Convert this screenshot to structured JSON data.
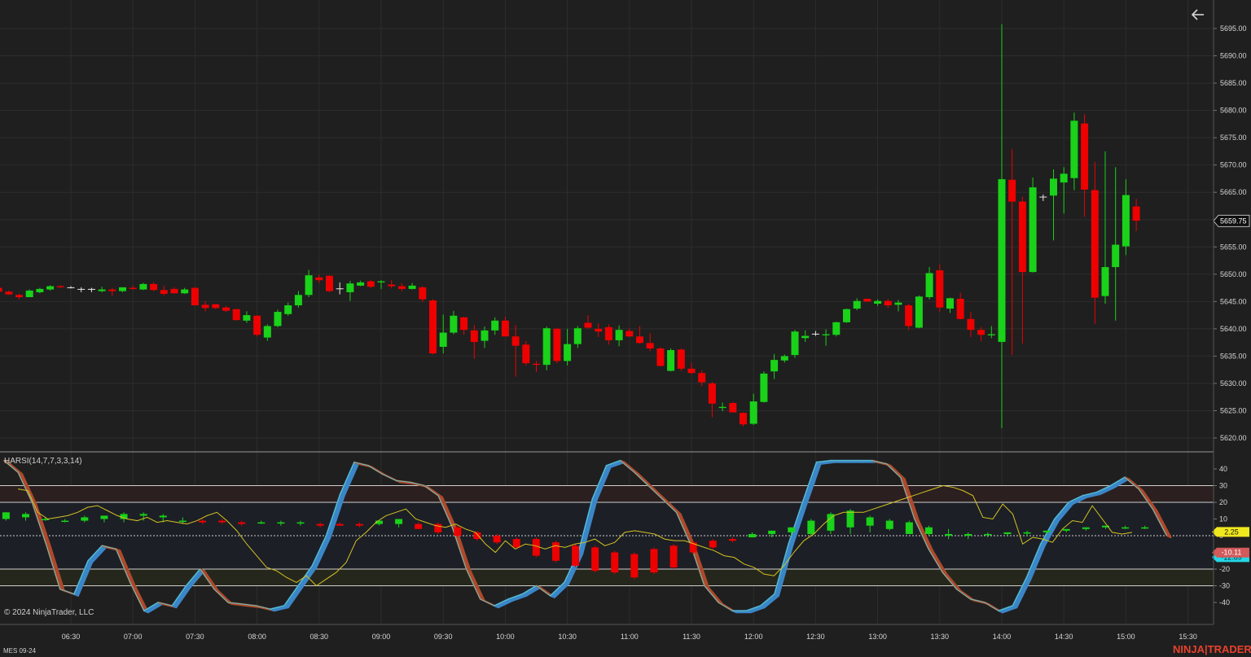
{
  "instrument": "MES 09-24",
  "brand": {
    "left": "NINJA",
    "right": "TRADER",
    "color": "#e8412c"
  },
  "copyright": "© 2024 NinjaTrader, LLC",
  "indicator_label": "HARSI(14,7,7,3,3,14)",
  "colors": {
    "up": "#19d219",
    "down": "#ee0000",
    "background": "#1f1f1f",
    "grid": "#2d2d2d",
    "text": "#d6d6d6",
    "rsi_line": "#d4c322",
    "stoch_up": "#3a86c8",
    "stoch_down": "#b0482a"
  },
  "price_axis": {
    "ticks": [
      "5695.00",
      "5690.00",
      "5685.00",
      "5680.00",
      "5675.00",
      "5670.00",
      "5665.00",
      "5660.00",
      "5655.00",
      "5650.00",
      "5645.00",
      "5640.00",
      "5635.00",
      "5630.00",
      "5625.00",
      "5620.00"
    ],
    "current_price": "5659.75"
  },
  "oscillator_axis": {
    "ticks": [
      "40",
      "30",
      "20",
      "10",
      "0",
      "-10",
      "-20",
      "-30",
      "-40"
    ],
    "label_rsi": "2.25",
    "label_red": "-10.11",
    "label_cyan": "-12.89"
  },
  "time_axis": {
    "ticks": [
      "06:30",
      "07:00",
      "07:30",
      "08:00",
      "08:30",
      "09:00",
      "09:30",
      "10:00",
      "10:30",
      "11:00",
      "11:30",
      "12:00",
      "12:30",
      "13:00",
      "13:30",
      "14:00",
      "14:30",
      "15:00",
      "15:30"
    ]
  },
  "chart_data": {
    "type": "candlestick",
    "price_range": [
      5618,
      5698
    ],
    "bar_spacing_minutes": 5,
    "first_bar": "05:50",
    "candles": [
      [
        5647.5,
        5648,
        5647,
        5647.6
      ],
      [
        5647.5,
        5647.6,
        5646.6,
        5646.8
      ],
      [
        5646.8,
        5647,
        5646.2,
        5646.3
      ],
      [
        5646.2,
        5646.4,
        5645.4,
        5645.8
      ],
      [
        5645.8,
        5647.2,
        5645.8,
        5647
      ],
      [
        5646.7,
        5647.5,
        5646.5,
        5647.3
      ],
      [
        5647.2,
        5648,
        5647,
        5647.8
      ],
      [
        5647.8,
        5648,
        5647.5,
        5647.6
      ],
      [
        5647.6,
        5647.8,
        5647.4,
        5647.5
      ],
      [
        5647.3,
        5647.6,
        5646.7,
        5647.2
      ],
      [
        5647.2,
        5647.5,
        5646.7,
        5647.3
      ],
      [
        5646.9,
        5647.7,
        5646.7,
        5647.2
      ],
      [
        5647.2,
        5647.5,
        5646,
        5646.9
      ],
      [
        5646.9,
        5647.6,
        5646.7,
        5647.6
      ],
      [
        5647.5,
        5647.9,
        5647.1,
        5647.3
      ],
      [
        5647.2,
        5648.4,
        5647.1,
        5648.2
      ],
      [
        5648.2,
        5648.5,
        5646.9,
        5647.1
      ],
      [
        5647.1,
        5647.9,
        5646.1,
        5646.4
      ],
      [
        5647.3,
        5647.6,
        5646.5,
        5646.5
      ],
      [
        5646.5,
        5647.5,
        5646.4,
        5647.2
      ],
      [
        5647.5,
        5647.6,
        5644.3,
        5644.3
      ],
      [
        5644.4,
        5645.1,
        5643.2,
        5643.8
      ],
      [
        5644.5,
        5644.5,
        5643.6,
        5643.8
      ],
      [
        5643.9,
        5644.2,
        5643.1,
        5643.3
      ],
      [
        5643.6,
        5643.6,
        5641.5,
        5641.6
      ],
      [
        5641.5,
        5643.2,
        5641.1,
        5642.5
      ],
      [
        5642.4,
        5642.5,
        5638.6,
        5638.9
      ],
      [
        5638.4,
        5640.8,
        5637.8,
        5640.5
      ],
      [
        5640.5,
        5643.5,
        5640.3,
        5643.1
      ],
      [
        5642.7,
        5644.8,
        5642.4,
        5644.3
      ],
      [
        5644.3,
        5646.9,
        5643.9,
        5646.2
      ],
      [
        5646.2,
        5650.8,
        5645.8,
        5649.8
      ],
      [
        5649.4,
        5649.9,
        5648.4,
        5648.9
      ],
      [
        5649.7,
        5649.8,
        5646.7,
        5646.9
      ],
      [
        5647.3,
        5648.5,
        5646.3,
        5647.4
      ],
      [
        5646.7,
        5648.8,
        5645.1,
        5648.3
      ],
      [
        5647.9,
        5648.8,
        5647.8,
        5648.5
      ],
      [
        5648.7,
        5649,
        5647.5,
        5647.7
      ],
      [
        5648.5,
        5648.9,
        5647.3,
        5648.7
      ],
      [
        5648.1,
        5648.9,
        5647.4,
        5647.8
      ],
      [
        5647.8,
        5648.4,
        5646.9,
        5647.3
      ],
      [
        5647.3,
        5648.4,
        5647.2,
        5647.9
      ],
      [
        5647.6,
        5647.8,
        5644.9,
        5645.4
      ],
      [
        5645.2,
        5645.4,
        5635.3,
        5635.5
      ],
      [
        5636.7,
        5642.6,
        5635.5,
        5639.3
      ],
      [
        5639.3,
        5643.3,
        5639,
        5642.4
      ],
      [
        5642.1,
        5642.2,
        5638.9,
        5639.8
      ],
      [
        5639.7,
        5640.7,
        5634.5,
        5637.6
      ],
      [
        5637.8,
        5640.4,
        5636.5,
        5639.7
      ],
      [
        5639.7,
        5642.1,
        5638.9,
        5641.5
      ],
      [
        5641.5,
        5642.2,
        5638.6,
        5638.6
      ],
      [
        5638.6,
        5640.7,
        5631.2,
        5636.9
      ],
      [
        5637.1,
        5637.8,
        5633.3,
        5633.7
      ],
      [
        5633.6,
        5634.1,
        5632.1,
        5633.4
      ],
      [
        5633.4,
        5640.4,
        5632.4,
        5640.1
      ],
      [
        5640,
        5640.2,
        5633.7,
        5634.1
      ],
      [
        5634.1,
        5640,
        5633.3,
        5637.2
      ],
      [
        5637.2,
        5640.5,
        5636.5,
        5640.1
      ],
      [
        5641.1,
        5642.5,
        5640,
        5640.2
      ],
      [
        5640,
        5641,
        5638.5,
        5639.5
      ],
      [
        5640.3,
        5640.8,
        5637.1,
        5637.9
      ],
      [
        5637.9,
        5640.6,
        5636.8,
        5639.8
      ],
      [
        5639.6,
        5640.1,
        5638.5,
        5638.6
      ],
      [
        5638.6,
        5640.5,
        5637.3,
        5637.4
      ],
      [
        5637.4,
        5639.2,
        5635.9,
        5636.4
      ],
      [
        5636.4,
        5636.6,
        5633.1,
        5633.2
      ],
      [
        5632.3,
        5636.4,
        5632.2,
        5636.1
      ],
      [
        5636.2,
        5636.4,
        5632.3,
        5632.7
      ],
      [
        5632.7,
        5633.8,
        5631.7,
        5631.9
      ],
      [
        5631.9,
        5632.4,
        5629.5,
        5630.2
      ],
      [
        5630,
        5630.3,
        5623.8,
        5626.3
      ],
      [
        5625.5,
        5626.5,
        5624.9,
        5625.7
      ],
      [
        5626.4,
        5626.6,
        5624.7,
        5624.7
      ],
      [
        5624.6,
        5624.7,
        5622.1,
        5622.5
      ],
      [
        5622.6,
        5628.1,
        5622.4,
        5626.7
      ],
      [
        5626.6,
        5632.2,
        5626.5,
        5631.8
      ],
      [
        5632.2,
        5635.4,
        5630.8,
        5634.3
      ],
      [
        5634.2,
        5635.3,
        5633.8,
        5635
      ],
      [
        5635.2,
        5639.8,
        5634.7,
        5639.5
      ],
      [
        5638.3,
        5639.7,
        5637.6,
        5638.7
      ],
      [
        5639.1,
        5639.6,
        5638.7,
        5639.1
      ],
      [
        5638.8,
        5639.9,
        5636.9,
        5639
      ],
      [
        5638.9,
        5641.3,
        5638.6,
        5641.2
      ],
      [
        5641.2,
        5643.7,
        5641.1,
        5643.6
      ],
      [
        5643.7,
        5645.6,
        5643.4,
        5645.1
      ],
      [
        5645.5,
        5645.5,
        5644.9,
        5645
      ],
      [
        5644.6,
        5645.4,
        5644.2,
        5645.1
      ],
      [
        5645.1,
        5645.5,
        5643.8,
        5644.3
      ],
      [
        5644.4,
        5645.3,
        5643.2,
        5644.8
      ],
      [
        5644.3,
        5644.6,
        5639.8,
        5640.5
      ],
      [
        5640.2,
        5646.1,
        5640.1,
        5645.9
      ],
      [
        5645.8,
        5651.3,
        5645.4,
        5650.2
      ],
      [
        5650.7,
        5651.8,
        5643.1,
        5643.9
      ],
      [
        5643.7,
        5645.7,
        5642.9,
        5645.6
      ],
      [
        5645.5,
        5646.6,
        5641.7,
        5641.8
      ],
      [
        5641.8,
        5643.1,
        5638.5,
        5639.8
      ],
      [
        5639.8,
        5640.3,
        5637.7,
        5638.9
      ],
      [
        5638.8,
        5640.5,
        5638.3,
        5639
      ],
      [
        5637.6,
        5695.8,
        5621.8,
        5667.4
      ],
      [
        5667.3,
        5672.9,
        5635.2,
        5663.3
      ],
      [
        5663.3,
        5664.2,
        5637.3,
        5650.4
      ],
      [
        5650.4,
        5667.7,
        5650.3,
        5665.9
      ],
      [
        5664.2,
        5664.6,
        5663.4,
        5664.2
      ],
      [
        5664.4,
        5669.2,
        5656.2,
        5667.5
      ],
      [
        5666.8,
        5669.6,
        5661.1,
        5668.4
      ],
      [
        5667.6,
        5679.6,
        5665.4,
        5678.1
      ],
      [
        5677.6,
        5679.3,
        5660.5,
        5665.5
      ],
      [
        5665.4,
        5670.6,
        5640.9,
        5645.7
      ],
      [
        5646,
        5672.5,
        5644.6,
        5651.3
      ],
      [
        5651.3,
        5669.6,
        5641.5,
        5655.4
      ],
      [
        5655.1,
        5667.4,
        5653.5,
        5664.5
      ],
      [
        5662.4,
        5663.8,
        5657.9,
        5659.8
      ]
    ],
    "harsi": {
      "range": [
        -45,
        45
      ],
      "overbought": [
        20,
        30
      ],
      "oversold": [
        -20,
        -30
      ],
      "ha_candles": [
        [
          10,
          14,
          9,
          14
        ],
        [
          11,
          14,
          9,
          13
        ],
        [
          10,
          11,
          9,
          10
        ],
        [
          9,
          10,
          8,
          9
        ],
        [
          9,
          12,
          8,
          11
        ],
        [
          10,
          12,
          8,
          12
        ],
        [
          10,
          14,
          8,
          13
        ],
        [
          12,
          14,
          9,
          13
        ],
        [
          11,
          13,
          8,
          12
        ],
        [
          9,
          11,
          7,
          9
        ],
        [
          9,
          10,
          7,
          8
        ],
        [
          9,
          10,
          7,
          8
        ],
        [
          8,
          9,
          6,
          7
        ],
        [
          8,
          9,
          7,
          8
        ],
        [
          8,
          9,
          6,
          8
        ],
        [
          8,
          9,
          6,
          8
        ],
        [
          7,
          8,
          5,
          6
        ],
        [
          7,
          8,
          6,
          6
        ],
        [
          7,
          8,
          5,
          6
        ],
        [
          7,
          9,
          6,
          9
        ],
        [
          7,
          10,
          5,
          10
        ],
        [
          7,
          8,
          4,
          4
        ],
        [
          7,
          8,
          1,
          2
        ],
        [
          5,
          6,
          -1,
          0
        ],
        [
          2,
          3,
          -3,
          -2
        ],
        [
          0,
          1,
          -5,
          -4
        ],
        [
          -2,
          -1,
          -8,
          -7
        ],
        [
          -2,
          -1,
          -13,
          -12
        ],
        [
          -4,
          -3,
          -16,
          -15
        ],
        [
          -6,
          -5,
          -19,
          -18
        ],
        [
          -7,
          -6,
          -22,
          -21
        ],
        [
          -10,
          -9,
          -23,
          -22
        ],
        [
          -11,
          -10,
          -26,
          -25
        ],
        [
          -8,
          -7,
          -23,
          -22
        ],
        [
          -6,
          -5,
          -20,
          -19
        ],
        [
          -4,
          -3,
          -11,
          -10
        ],
        [
          -3,
          -2,
          -8,
          -7
        ],
        [
          -2,
          -1,
          -4,
          -3
        ],
        [
          -1,
          0,
          2,
          1
        ],
        [
          1,
          3,
          -1,
          3
        ],
        [
          2,
          5,
          0,
          5
        ],
        [
          1,
          10,
          0,
          9
        ],
        [
          3,
          14,
          1,
          13
        ],
        [
          5,
          16,
          1,
          15
        ],
        [
          6,
          12,
          2,
          11
        ],
        [
          4,
          10,
          3,
          9
        ],
        [
          1,
          9,
          1,
          8
        ],
        [
          1,
          6,
          0,
          5
        ],
        [
          0,
          4,
          -2,
          1
        ],
        [
          0,
          2,
          -2,
          1
        ],
        [
          1,
          2,
          -1,
          1
        ],
        [
          1,
          2,
          0,
          2
        ],
        [
          2,
          3,
          0,
          2
        ],
        [
          2,
          3,
          1,
          3
        ],
        [
          3,
          4,
          2,
          4
        ],
        [
          4,
          5,
          3,
          5
        ],
        [
          5,
          6,
          4,
          6
        ],
        [
          5,
          6,
          4,
          5
        ],
        [
          5,
          6,
          4,
          5
        ]
      ],
      "rsi": [
        28,
        27,
        14,
        10,
        11,
        12,
        14,
        17,
        18,
        15,
        12,
        10,
        9,
        11,
        8,
        9,
        8,
        7,
        9,
        12,
        14,
        9,
        3,
        -5,
        -12,
        -19,
        -21,
        -25,
        -28,
        -24,
        -30,
        -26,
        -22,
        -16,
        -3,
        2,
        8,
        12,
        14,
        16,
        10,
        8,
        6,
        5,
        7,
        4,
        2,
        -5,
        -10,
        -3,
        -8,
        -5,
        -6,
        -8,
        -6,
        -7,
        -5,
        -4,
        -2,
        -6,
        -4,
        2,
        3,
        2,
        1,
        -2,
        -3,
        -3,
        -5,
        -7,
        -9,
        -12,
        -13,
        -17,
        -19,
        -23,
        -24,
        -18,
        -10,
        -3,
        1,
        7,
        12,
        14,
        14,
        14,
        16,
        18,
        20,
        22,
        24,
        26,
        28,
        30,
        29,
        27,
        24,
        11,
        10,
        19,
        13,
        -5,
        -1,
        -2,
        -4,
        4,
        9,
        8,
        18,
        10,
        2,
        1,
        2
      ],
      "stoch": [
        45,
        38,
        20,
        -5,
        -32,
        -35,
        -15,
        -6,
        -8,
        -28,
        -45,
        -40,
        -42,
        -30,
        -20,
        -32,
        -40,
        -41,
        -42,
        -44,
        -42,
        -30,
        -18,
        0,
        25,
        44,
        42,
        37,
        33,
        32,
        30,
        24,
        5,
        -20,
        -38,
        -42,
        -38,
        -35,
        -30,
        -36,
        -28,
        -10,
        22,
        42,
        45,
        38,
        30,
        22,
        14,
        -5,
        -30,
        -40,
        -45,
        -45,
        -42,
        -35,
        -5,
        20,
        44,
        45,
        45,
        45,
        45,
        43,
        35,
        10,
        -8,
        -22,
        -32,
        -38,
        -40,
        -45,
        -42,
        -25,
        -5,
        10,
        20,
        24,
        26,
        30,
        35,
        28,
        16,
        0
      ]
    }
  }
}
